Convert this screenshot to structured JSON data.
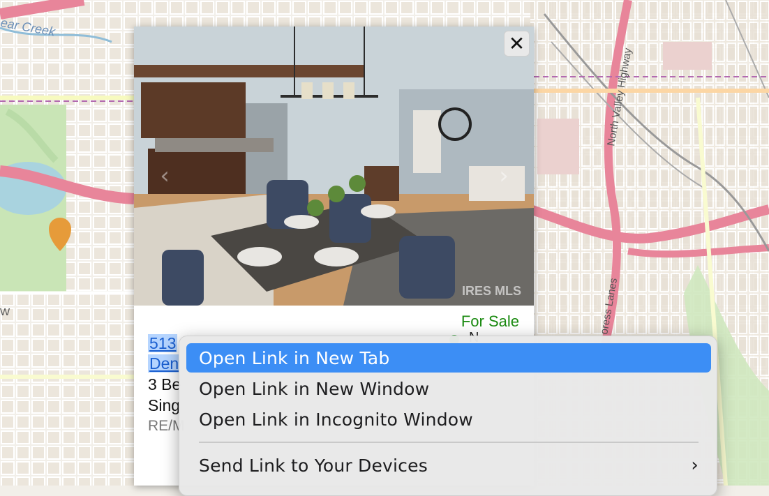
{
  "map": {
    "labels": [
      {
        "text": "ear Creek",
        "kind": "street"
      },
      {
        "text": "North Valley Highway",
        "kind": "highway"
      },
      {
        "text": "oress Lanes",
        "kind": "street"
      },
      {
        "text": "W",
        "kind": "edge"
      }
    ]
  },
  "listing_popup": {
    "close_label": "✕",
    "status": "For Sale",
    "status_extra": "N",
    "address_line1": "513",
    "address_line2": "Den",
    "details_line1": "3 Be",
    "details_line2": "Sing",
    "brokerage": "RE/M",
    "watermark": "IRES MLS"
  },
  "context_menu": {
    "items": [
      {
        "label": "Open Link in New Tab"
      },
      {
        "label": "Open Link in New Window"
      },
      {
        "label": "Open Link in Incognito Window"
      },
      {
        "label": "Send Link to Your Devices"
      }
    ],
    "submenu_arrow": "›"
  },
  "colors": {
    "status_green": "#1a8a10",
    "link_blue": "#1a5fd0",
    "menu_highlight": "#3c8ef5",
    "highway_pink": "#e8859a"
  }
}
